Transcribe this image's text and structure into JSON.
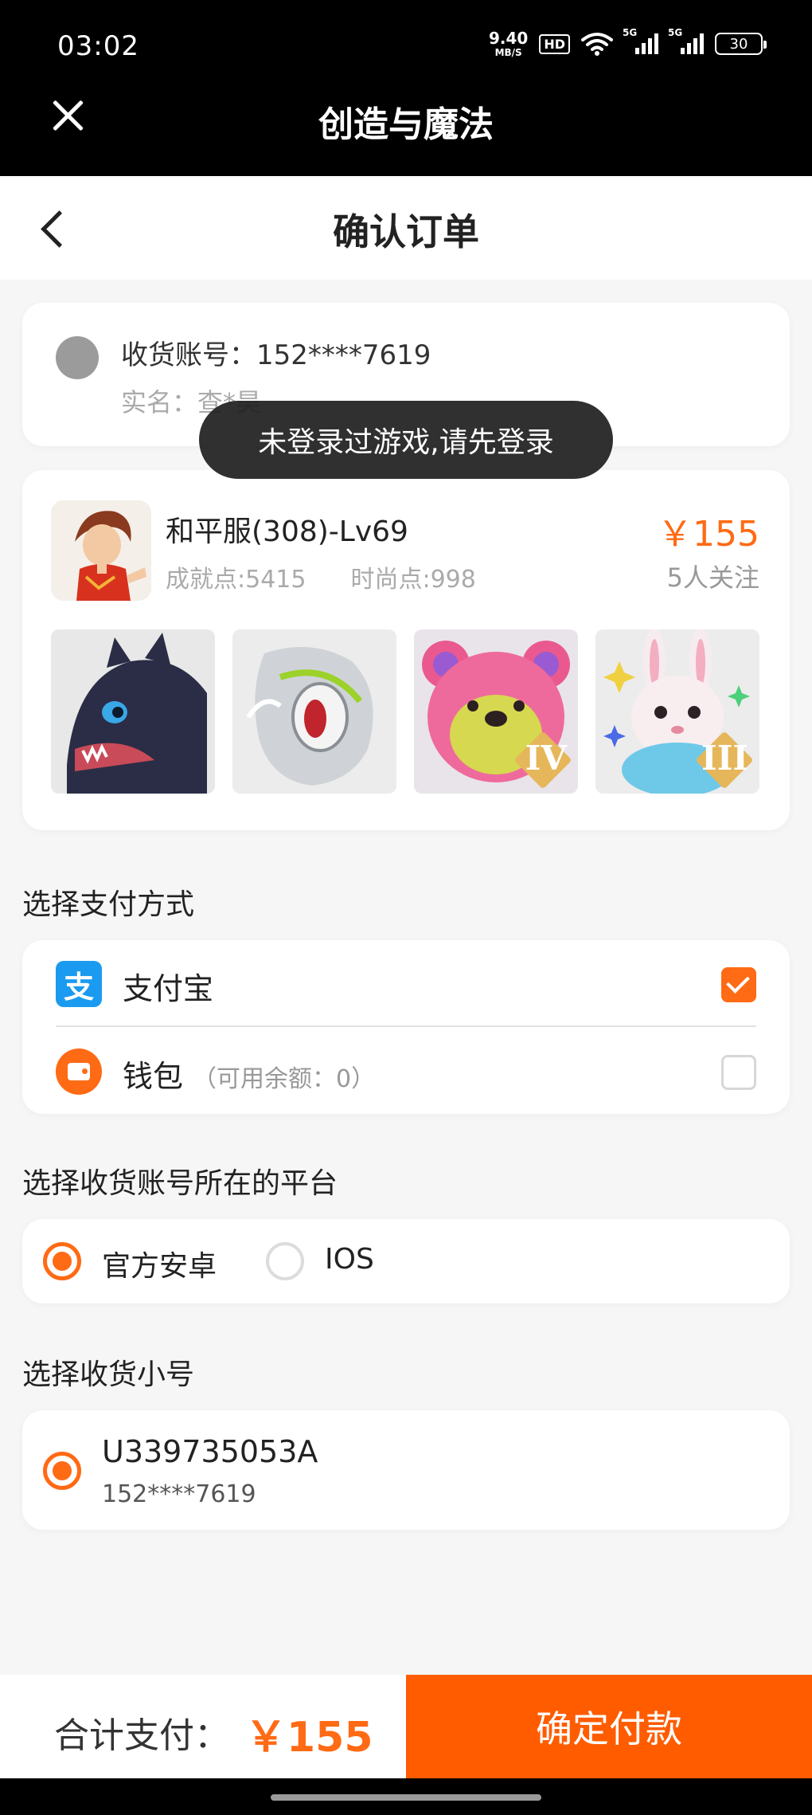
{
  "status": {
    "time": "03:02",
    "speed_value": "9.40",
    "speed_unit": "MB/S",
    "hd": "HD",
    "net1": "5G",
    "net2": "5G",
    "battery": "30"
  },
  "app": {
    "title": "创造与魔法"
  },
  "page": {
    "title": "确认订单"
  },
  "account": {
    "line1": "收货账号：152****7619",
    "line2": "实名：查*昊"
  },
  "toast": "未登录过游戏,请先登录",
  "product": {
    "name": "和平服(308)-Lv69",
    "achievement": "成就点:5415",
    "fashion": "时尚点:998",
    "price": "￥155",
    "followers": "5人关注",
    "thumbs": [
      {
        "icon": "black-dragon-pet"
      },
      {
        "icon": "silver-mount-pet"
      },
      {
        "icon": "pink-bear-pet",
        "badge": "IV"
      },
      {
        "icon": "white-rabbit-pet",
        "badge": "III"
      }
    ]
  },
  "payment": {
    "section_label": "选择支付方式",
    "options": [
      {
        "label": "支付宝",
        "note": "",
        "selected": true,
        "icon": "alipay-icon",
        "icon_glyph": "支"
      },
      {
        "label": "钱包",
        "note": "（可用余额：0）",
        "selected": false,
        "icon": "wallet-icon"
      }
    ]
  },
  "platform": {
    "section_label": "选择收货账号所在的平台",
    "options": [
      {
        "label": "官方安卓",
        "selected": true
      },
      {
        "label": "IOS",
        "selected": false
      }
    ]
  },
  "sub_account": {
    "section_label": "选择收货小号",
    "id": "U339735053A",
    "phone": "152****7619",
    "selected": true
  },
  "footer": {
    "total_label": "合计支付：",
    "total_amount": "￥155",
    "pay_button": "确定付款"
  },
  "colors": {
    "accent": "#ff6a14",
    "button": "#ff5c00",
    "alipay": "#1a9bf0"
  }
}
